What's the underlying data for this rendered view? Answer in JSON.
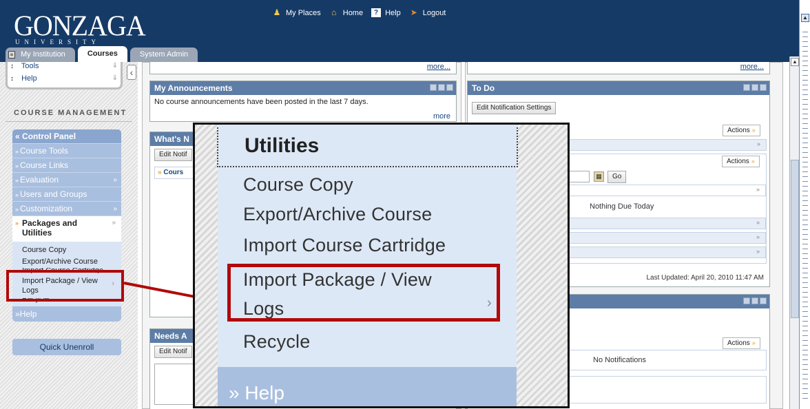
{
  "header": {
    "logo_main": "GONZAGA",
    "logo_sub": "UNIVERSITY",
    "links": [
      {
        "label": "My Places",
        "icon": "person-icon"
      },
      {
        "label": "Home",
        "icon": "home-icon"
      },
      {
        "label": "Help",
        "icon": "help-icon"
      },
      {
        "label": "Logout",
        "icon": "logout-icon"
      }
    ],
    "tabs": [
      {
        "label": "My Institution"
      },
      {
        "label": "Courses"
      },
      {
        "label": "System Admin"
      }
    ],
    "help_glyph": "?"
  },
  "sidebar": {
    "tools": [
      "Tools",
      "Help"
    ],
    "course_management": "COURSE MANAGEMENT",
    "control_panel": "Control Panel",
    "items": [
      {
        "label": "Course Tools"
      },
      {
        "label": "Course Links"
      },
      {
        "label": "Evaluation"
      },
      {
        "label": "Users and Groups"
      },
      {
        "label": "Customization"
      }
    ],
    "open_section": "Packages and Utilities",
    "open_section_lines": [
      "Packages and",
      "Utilities"
    ],
    "sub_items": [
      "Course Copy",
      "Export/Archive Course",
      "Import Course Cartridge",
      "Import Package / View Logs",
      "Recycle"
    ],
    "sub_item_lines": [
      "Import Package / View",
      "Logs"
    ],
    "help": "Help",
    "quick_unenroll": "Quick Unenroll"
  },
  "main": {
    "more": "more...",
    "more_short": "more",
    "announcements_title": "My Announcements",
    "announcements_text": "No course announcements have been posted in the last 7 days.",
    "whats_new_title": "What's N",
    "edit_notif_short": "Edit Notif",
    "courses_label": "Cours",
    "needs_attention_title": "Needs A",
    "todo_title": "To Do",
    "edit_notification_settings": "Edit Notification Settings",
    "actions": "Actions",
    "go": "Go",
    "nothing_due_today": "Nothing Due Today",
    "last_updated": "Last Updated: April 20, 2010 11:47 AM",
    "no_notifications": "No Notifications"
  },
  "zoom": {
    "utilities": "Utilities",
    "items": [
      "Course Copy",
      "Export/Archive Course",
      "Import Course Cartridge",
      "Import Package / View",
      "Logs",
      "Recycle"
    ],
    "help": "Help"
  },
  "colors": {
    "header_bg": "#163a66",
    "accent_blue": "#5d7da6",
    "menu_blue": "#a9bfdf",
    "highlight_red": "#b10a0a"
  }
}
